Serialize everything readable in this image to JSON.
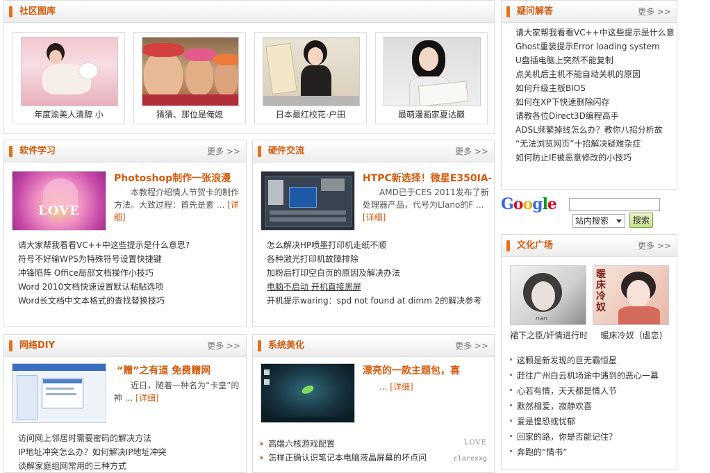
{
  "gallery": {
    "title": "社区图库",
    "items": [
      {
        "caption": "年度渝美人清醇 小"
      },
      {
        "caption": "猜猜、那位是俺媳"
      },
      {
        "caption": "日本最红校花-户田"
      },
      {
        "caption": "最萌漫画家夏达巅"
      }
    ]
  },
  "qa": {
    "title": "疑问解答",
    "more": "更多 >>",
    "items": [
      "请大家帮我看看VC++中这些提示是什么意",
      "Ghost重装提示Error loading system",
      "U盘插电脑上突然不能复制",
      "点关机后主机不能自动关机的原因",
      "如何升级主板BIOS",
      "如何在XP下快速删除闪存",
      "请教各位Direct3D编程高手",
      "ADSL频繁掉线怎么办？教你八招分析故",
      "“无法浏览网页”十招解决疑难杂症",
      "如何防止IE被恶意修改的小技巧"
    ]
  },
  "software": {
    "title": "软件学习",
    "more": "更多 >>",
    "feature_title": "Photoshop制作一张浪漫",
    "feature_desc": "本教程介绍情人节贺卡的制作方法。大致过程：首先是素",
    "detail": "[详细]",
    "ellipsis": "...",
    "image_text": "LOVE",
    "items": [
      "请大家帮我看看VC++中这些提示是什么意思?",
      "符号不好输WPS为特殊符号设置快捷键",
      "冲锋陷阵  Office局部文档操作小技巧",
      "Word 2010文档快速设置默认粘贴选项",
      "Word长文档中文本格式的查找替换技巧"
    ]
  },
  "hardware": {
    "title": "硬件交流",
    "more": "更多 >>",
    "feature_title": "HTPC新选择！微星E350IA-",
    "feature_desc": "AMD已于CES 2011发布了新处理器产品，代号为Llano的F",
    "detail": "[详细]",
    "ellipsis": "...",
    "items": [
      "怎么解决HP喷墨打印机走纸不顺",
      "各种激光打印机故障排除",
      "加粉后打印空白页的原因及解决办法",
      "电脑不启动 开机直接黑屏",
      "开机提示waring：spd not found at dimm 2的解决参考"
    ]
  },
  "network": {
    "title": "网络DIY",
    "more": "更多 >>",
    "feature_title": "“赠”之有道 免费赠网",
    "feature_desc": "近日，随着一种名为“卡皇”的神",
    "detail": "[详细]",
    "ellipsis": "...",
    "items": [
      "访问网上邻居时需要密码的解决方法",
      "IP地址冲突怎么办？如何解决IP地址冲突",
      "谈解家庭组网常用的三种方式"
    ]
  },
  "beautify": {
    "title": "系统美化",
    "more": "更多 >>",
    "feature_title": "漂亮的一款主题包，喜",
    "feature_desc": "",
    "detail": "[详细]",
    "ellipsis": "...",
    "items": [
      "高端六核游戏配置",
      "怎样正确认识笔记本电脑液晶屏幕的坏点问"
    ],
    "watermark1": "LOVE",
    "watermark2": "clarexxg"
  },
  "search": {
    "logo": "Google",
    "placeholder": "",
    "select_value": "站内搜索",
    "button": "搜索",
    "logo_colors": [
      "#3369e8",
      "#d50f25",
      "#eeb211",
      "#3369e8",
      "#009925",
      "#d50f25"
    ]
  },
  "culture": {
    "title": "文化广场",
    "more": "更多 >>",
    "images": [
      {
        "caption": "裙下之臣/奸情进行时",
        "image_text": "nan"
      },
      {
        "caption": "暖床冷奴（虐恋)",
        "image_text": "暖床冷奴"
      }
    ],
    "items": [
      "这颗是新发现的巨无霸恒星",
      "赶往广州白云机场途中遇到的恶心一幕",
      "心若有情，天天都是情人节",
      "默然相爱，寂静欢喜",
      "爱是惶恐或忧郁",
      "回家的路，你是否能记住？",
      "奔跑的“情书”"
    ]
  },
  "colors": {
    "accent": "#d35a0c",
    "bar": "#e8701a"
  }
}
